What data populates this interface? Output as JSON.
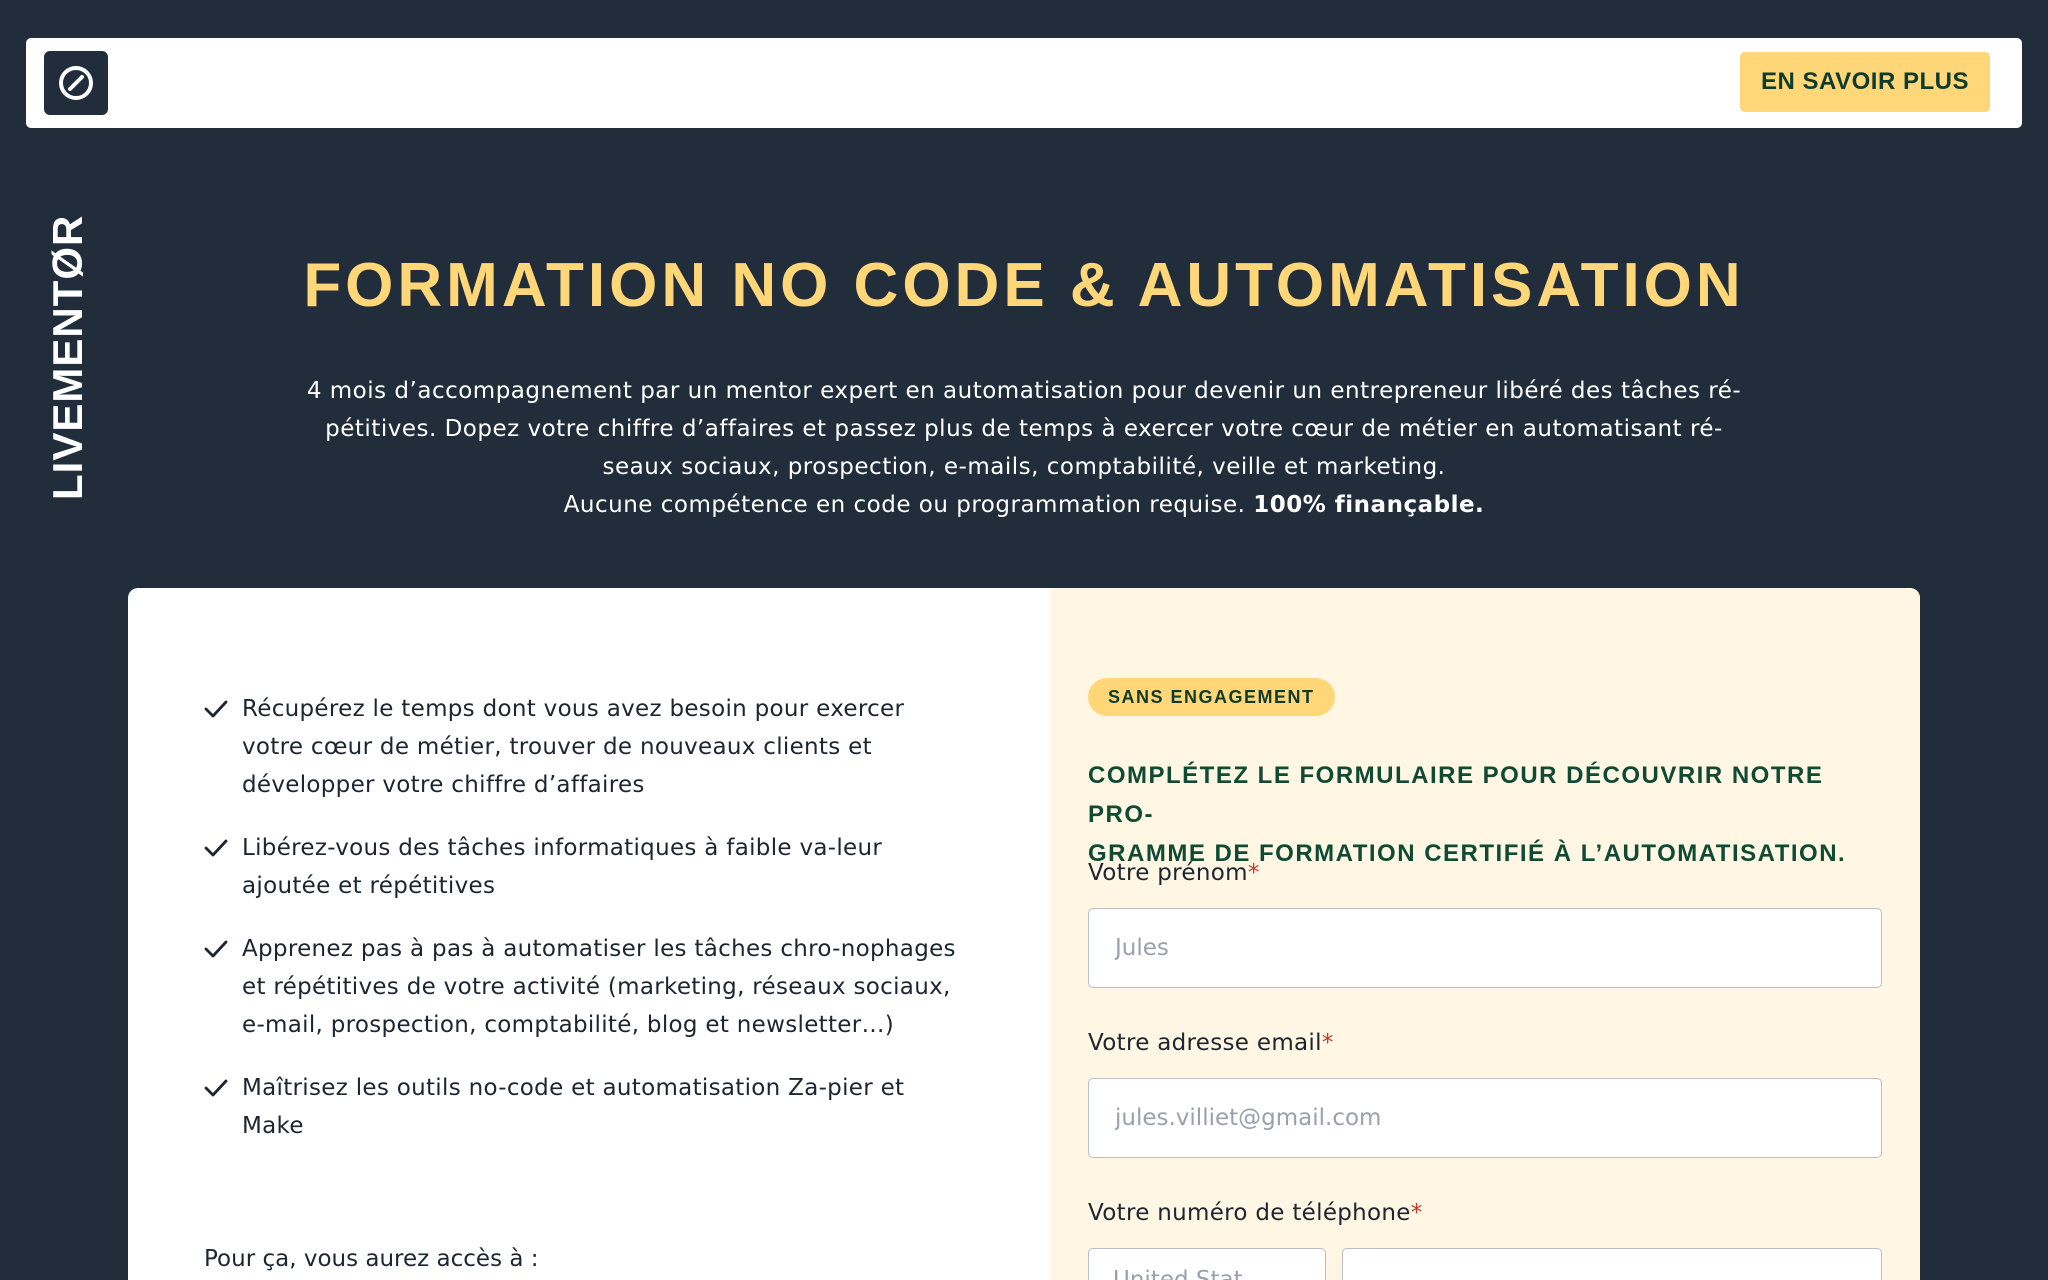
{
  "header": {
    "logo_icon": "compass-icon",
    "cta_label": "EN SAVOIR PLUS"
  },
  "brand": "LIVEMENTØR",
  "hero": {
    "title": "FORMATION NO CODE & AUTOMATISATION",
    "description_lines": [
      "4 mois d’accompagnement par un mentor expert en automatisation pour devenir un entrepreneur libéré des tâches ré-",
      "pétitives. Dopez votre chiffre d’affaires et passez plus de temps à exercer votre cœur de métier en automatisant ré-",
      "seaux sociaux, prospection, e-mails, comptabilité, veille et marketing.",
      "Aucune compétence en code ou programmation requise. "
    ],
    "description_bold": "100% finançable."
  },
  "benefits": [
    "Récupérez le temps dont vous avez besoin pour exercer votre cœur de métier, trouver de nouveaux clients et développer votre chiffre d’affaires",
    "Libérez-vous des tâches informatiques à faible va-leur ajoutée et répétitives",
    "Apprenez pas à pas à automatiser les tâches chro-nophages et répétitives de votre activité (marketing, réseaux sociaux, e-mail, prospection, comptabilité, blog et newsletter…)",
    "Maîtrisez les outils no-code et automatisation Za-pier et Make"
  ],
  "access_text": "Pour ça, vous aurez accès à :",
  "form": {
    "badge": "SANS ENGAGEMENT",
    "heading_lines": [
      "COMPLÉTEZ LE FORMULAIRE POUR DÉCOUVRIR NOTRE PRO-",
      "GRAMME DE FORMATION CERTIFIÉ À L’AUTOMATISATION."
    ],
    "required_mark": "*",
    "first_name": {
      "label": "Votre prénom",
      "placeholder": "Jules",
      "value": ""
    },
    "email": {
      "label": "Votre adresse email",
      "placeholder": "jules.villiet@gmail.com",
      "value": ""
    },
    "phone": {
      "label": "Votre numéro de téléphone",
      "country_value": "United Stat"
    }
  },
  "colors": {
    "background": "#212d3b",
    "accent_yellow": "#ffd778",
    "form_panel": "#fff6e3",
    "heading_green": "#0f4a35",
    "required_red": "#c0392b"
  }
}
